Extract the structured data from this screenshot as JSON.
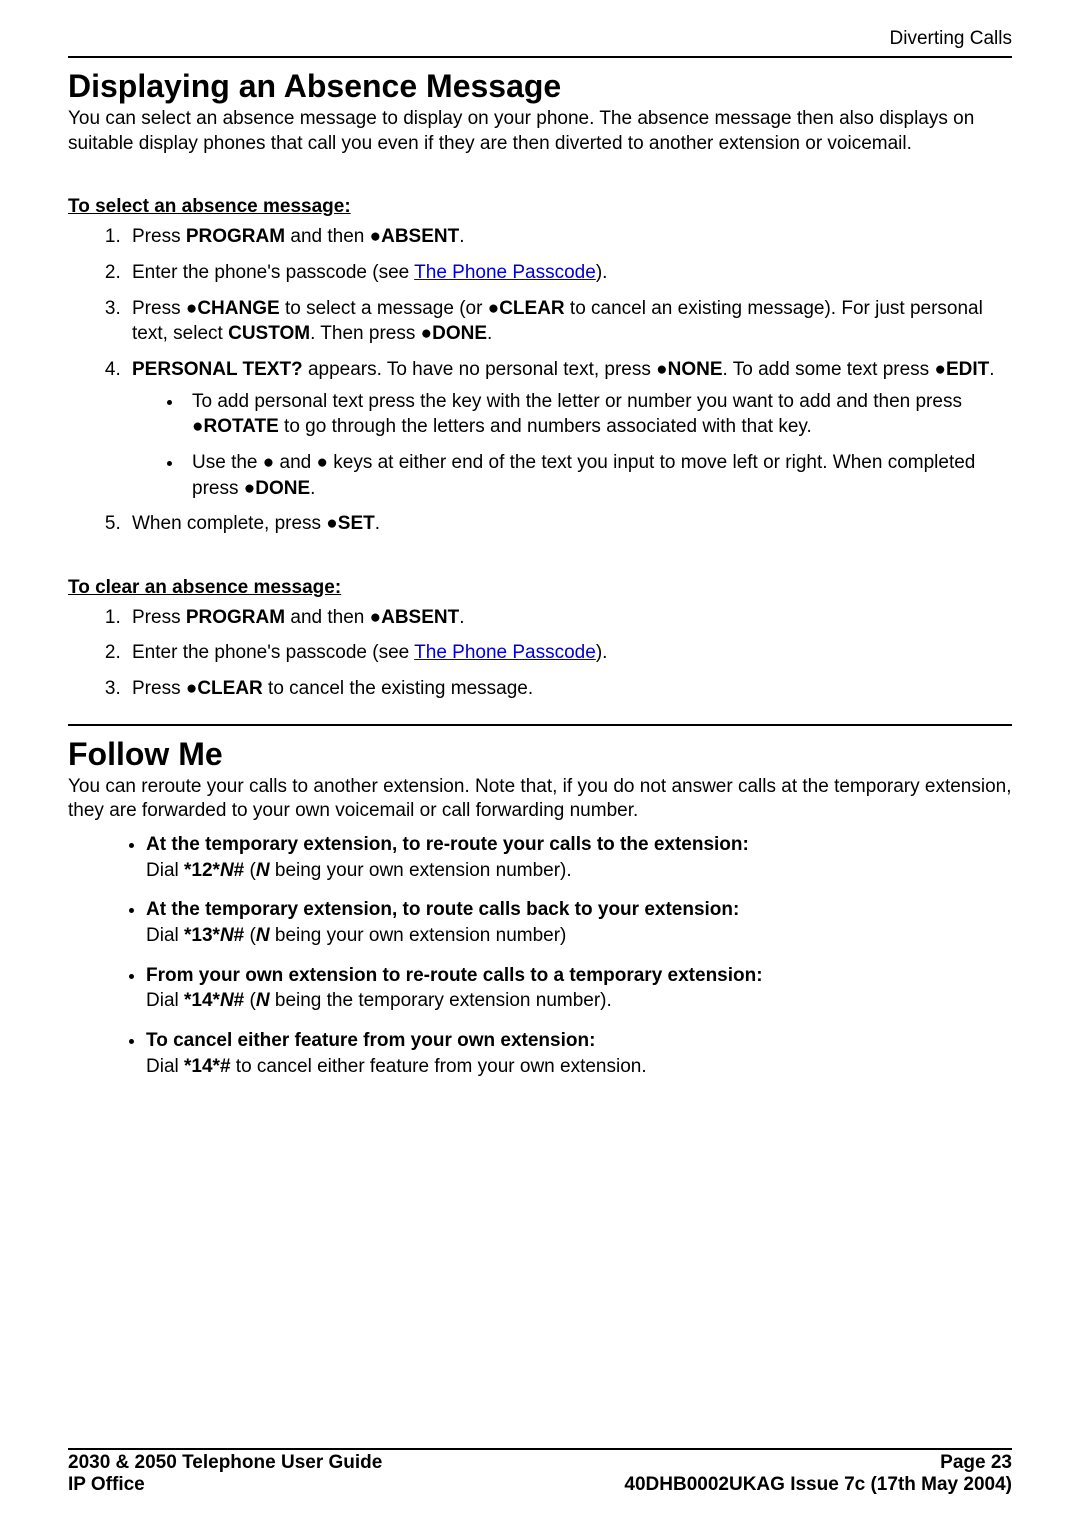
{
  "header": {
    "right": "Diverting Calls"
  },
  "section1": {
    "title": "Displaying an Absence Message",
    "intro": "You can select an absence message to display on your phone. The absence message then also displays on suitable display phones that call you even if they are then diverted to another extension or voicemail.",
    "sub1": "To select an absence message:",
    "s1_li1_a": "Press ",
    "s1_li1_b": "PROGRAM",
    "s1_li1_c": " and then ●",
    "s1_li1_d": "ABSENT",
    "s1_li1_e": ".",
    "s1_li2_a": "Enter the phone's passcode (see ",
    "s1_li2_link": "The Phone Passcode",
    "s1_li2_b": ").",
    "s1_li3_a": "Press ●",
    "s1_li3_b": "CHANGE",
    "s1_li3_c": " to select a message (or ●",
    "s1_li3_d": "CLEAR",
    "s1_li3_e": " to cancel an existing message). For just personal text, select ",
    "s1_li3_f": "CUSTOM",
    "s1_li3_g": ". Then press ●",
    "s1_li3_h": "DONE",
    "s1_li3_i": ".",
    "s1_li4_a": "PERSONAL TEXT?",
    "s1_li4_b": " appears. To have no personal text, press ●",
    "s1_li4_c": "NONE",
    "s1_li4_d": ". To add some text press ●",
    "s1_li4_e": "EDIT",
    "s1_li4_f": ".",
    "s1_li4_sub1_a": "To add personal text press the key with the letter or number you want to add and then press ●",
    "s1_li4_sub1_b": "ROTATE",
    "s1_li4_sub1_c": " to go through the letters and numbers associated with that key.",
    "s1_li4_sub2_a": "Use the ● and ● keys at either end of the text you input to move left or right. When completed press ●",
    "s1_li4_sub2_b": "DONE",
    "s1_li4_sub2_c": ".",
    "s1_li5_a": "When complete, press ●",
    "s1_li5_b": "SET",
    "s1_li5_c": ".",
    "sub2": "To clear an absence message:",
    "s2_li1_a": "Press ",
    "s2_li1_b": "PROGRAM",
    "s2_li1_c": " and then ●",
    "s2_li1_d": "ABSENT",
    "s2_li1_e": ".",
    "s2_li2_a": "Enter the phone's passcode (see ",
    "s2_li2_link": "The Phone Passcode",
    "s2_li2_b": ").",
    "s2_li3_a": "Press ●",
    "s2_li3_b": "CLEAR",
    "s2_li3_c": " to cancel the existing message."
  },
  "section2": {
    "title": "Follow Me",
    "intro": "You can reroute your calls to another extension. Note that, if you do not answer calls at the temporary extension, they are forwarded to your own voicemail or call forwarding number.",
    "b1_head": "At the temporary extension, to re-route your calls to the extension:",
    "b1_a": "Dial ",
    "b1_b": "*12*",
    "b1_c": "N",
    "b1_d": "#",
    "b1_e": " (",
    "b1_f": "N",
    "b1_g": " being your own extension number).",
    "b2_head": "At the temporary extension, to route calls back to your extension:",
    "b2_a": "Dial ",
    "b2_b": "*13*",
    "b2_c": "N",
    "b2_d": "#",
    "b2_e": " (",
    "b2_f": "N",
    "b2_g": " being your own extension number)",
    "b3_head": "From your own extension to re-route calls to a temporary extension:",
    "b3_a": "Dial ",
    "b3_b": "*14*",
    "b3_c": "N",
    "b3_d": "#",
    "b3_e": " (",
    "b3_f": "N",
    "b3_g": " being the temporary extension number).",
    "b4_head": "To cancel either feature from your own extension:",
    "b4_a": "Dial ",
    "b4_b": "*14*#",
    "b4_c": " to cancel either feature from your own extension."
  },
  "footer": {
    "left1": "2030 & 2050 Telephone User Guide",
    "right1": "Page 23",
    "left2": "IP Office",
    "right2": "40DHB0002UKAG Issue 7c (17th May 2004)"
  }
}
